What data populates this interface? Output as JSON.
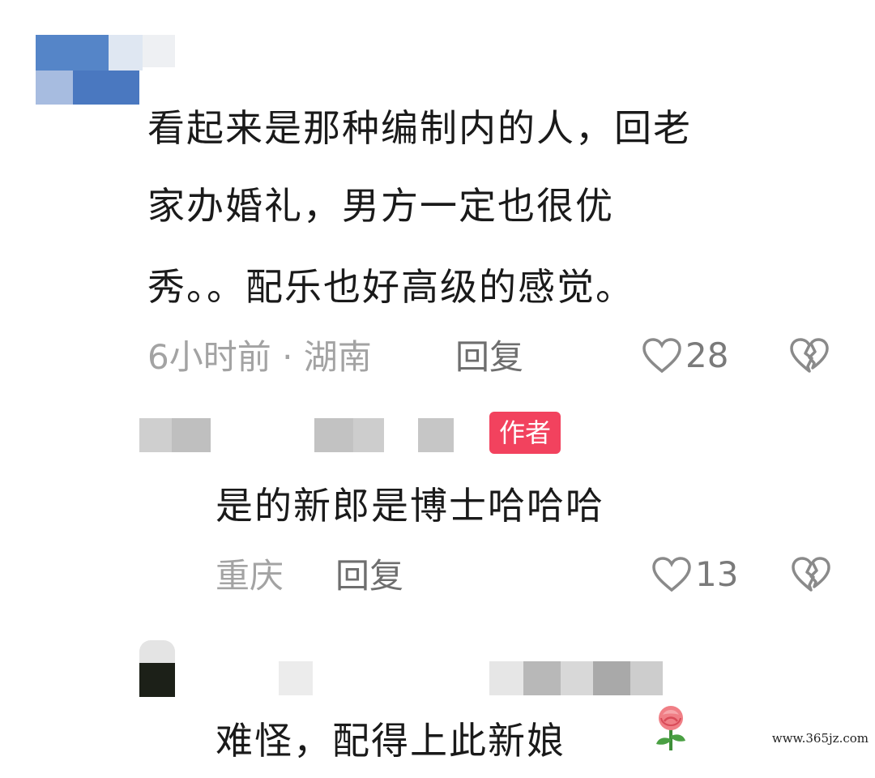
{
  "comments": [
    {
      "text_lines": [
        "看起来是那种编制内的人，回老",
        "家办婚礼，男方一定也很优",
        "秀。。配乐也好高级的感觉。"
      ],
      "meta": "6小时前 · 湖南",
      "reply_label": "回复",
      "likes": "28"
    },
    {
      "badge": "作者",
      "text_lines": [
        "是的新郎是博士哈哈哈"
      ],
      "meta": "重庆",
      "reply_label": "回复",
      "likes": "13"
    },
    {
      "text_lines": [
        "难怪，配得上此新娘"
      ],
      "emoji": "rose-emoji"
    }
  ],
  "watermark": "www.365jz.com",
  "colors": {
    "badge_bg": "#f2425e",
    "meta_gray": "#a3a3a3",
    "text": "#1a1a1a"
  }
}
